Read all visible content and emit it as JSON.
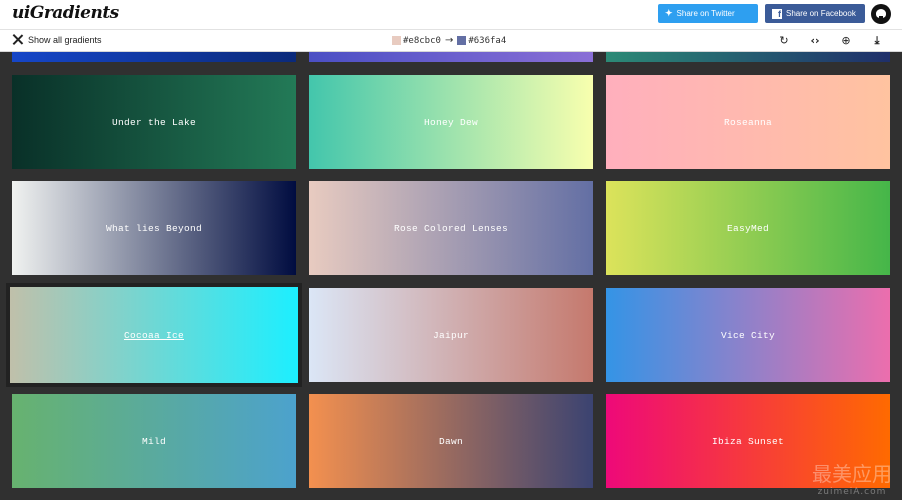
{
  "header": {
    "logo": "uiGradients",
    "twitter": {
      "icon": "twitter-icon",
      "label": "Share on Twitter"
    },
    "facebook": {
      "icon": "facebook-icon",
      "label": "Share on Facebook"
    },
    "github_icon": "github-icon"
  },
  "toolbar": {
    "show_all": "Show all gradients",
    "color_from": "#e8cbc0",
    "arrow": "→",
    "color_to": "#636fa4",
    "tools": [
      "rotate-icon",
      "code-icon",
      "add-icon",
      "download-icon"
    ]
  },
  "top_row": [
    {
      "colors": [
        "#1646c8",
        "#0b2a7a"
      ]
    },
    {
      "colors": [
        "#4b4fc4",
        "#8a6fd6"
      ]
    },
    {
      "colors": [
        "#2c8a76",
        "#1f2f6a"
      ]
    }
  ],
  "cards": [
    {
      "name": "Under the Lake",
      "from": "#093028",
      "to": "#237a57"
    },
    {
      "name": "Honey Dew",
      "from": "#43c6ac",
      "to": "#f8ffae"
    },
    {
      "name": "Roseanna",
      "from": "#ffafbd",
      "to": "#ffc3a0"
    },
    {
      "name": "What lies Beyond",
      "from": "#f0f2f0",
      "to": "#000c40"
    },
    {
      "name": "Rose Colored Lenses",
      "from": "#e8cbc0",
      "to": "#636fa4"
    },
    {
      "name": "EasyMed",
      "from": "#dce35b",
      "to": "#45b649"
    },
    {
      "name": "Cocoaa Ice",
      "from": "#c0c0aa",
      "to": "#1cefff",
      "hover": true
    },
    {
      "name": "Jaipur",
      "from": "#dbe6f6",
      "to": "#c5796d"
    },
    {
      "name": "Vice City",
      "from": "#3494e6",
      "to": "#ec6ead"
    },
    {
      "name": "Mild",
      "from": "#67b26f",
      "to": "#4ca2cd"
    },
    {
      "name": "Dawn",
      "from": "#f3904f",
      "to": "#3b4371"
    },
    {
      "name": "Ibiza Sunset",
      "from": "#ee0979",
      "to": "#ff6a00"
    }
  ],
  "watermark": {
    "cn": "最美应用",
    "en": "zuimeiA.com"
  }
}
